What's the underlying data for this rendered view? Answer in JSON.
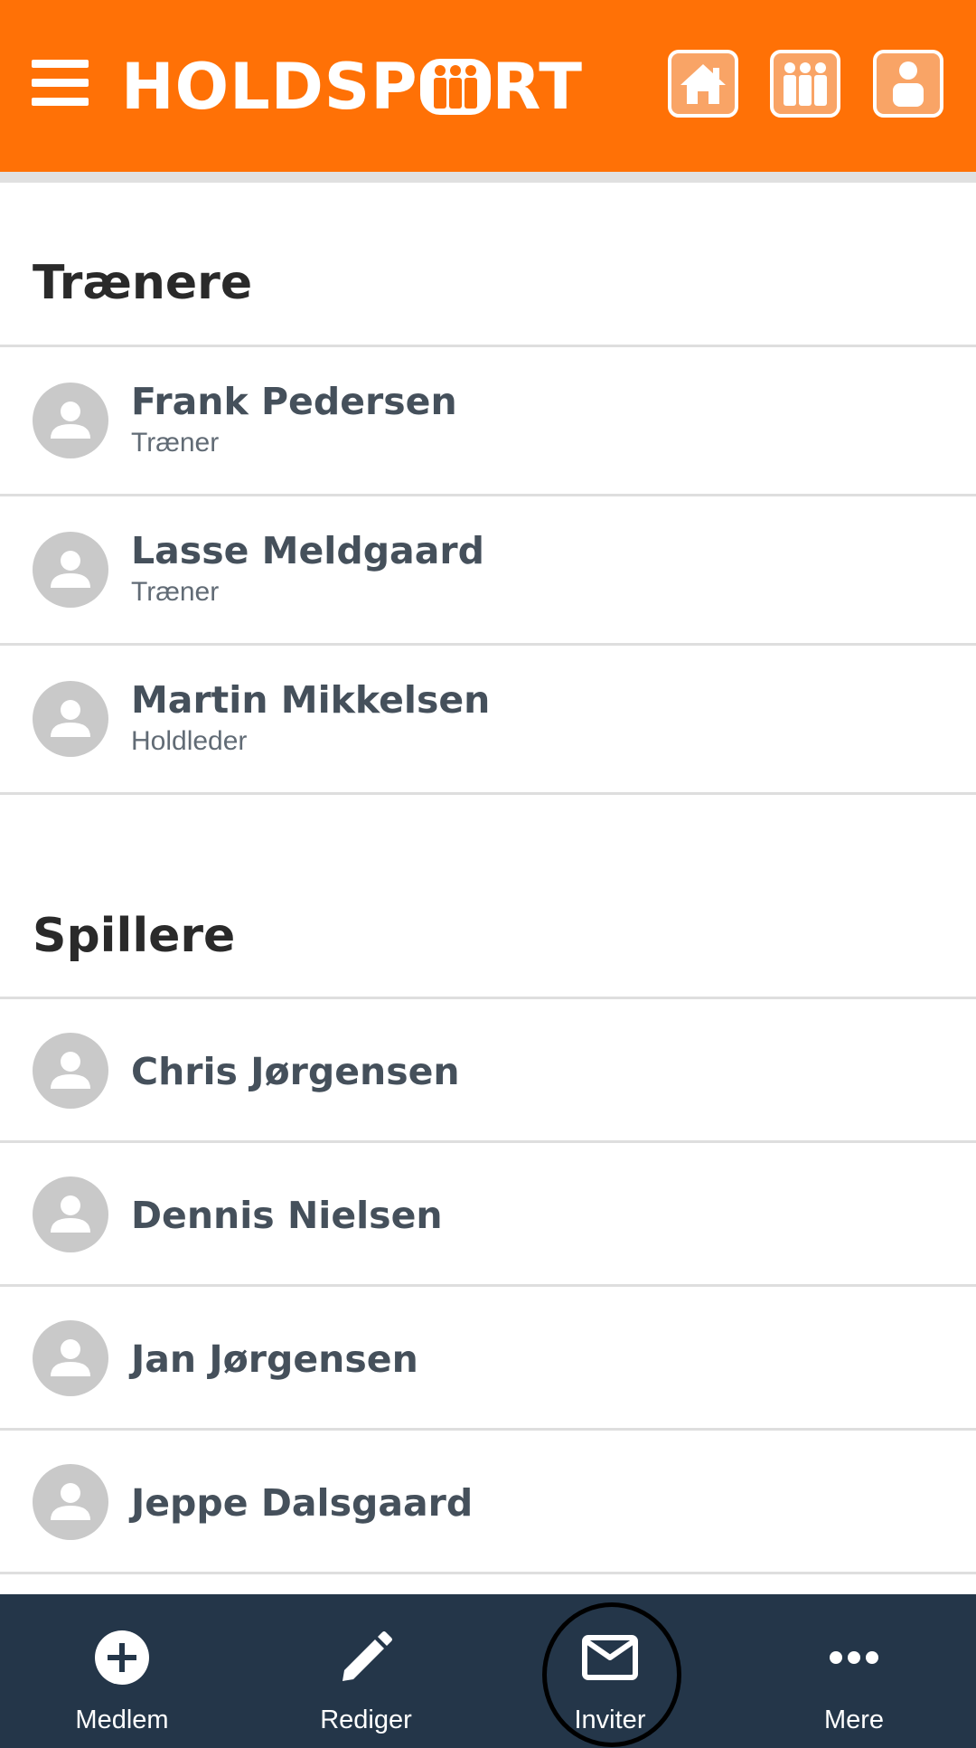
{
  "header": {
    "brand": "HOLDSPORT",
    "brand_before": "HOLDSP",
    "brand_after": "RT",
    "background": "#ff7106",
    "icons": [
      "home-icon",
      "team-icon",
      "profile-icon"
    ]
  },
  "sections": {
    "coaches": {
      "title": "Trænere",
      "members": [
        {
          "name": "Frank Pedersen",
          "role": "Træner"
        },
        {
          "name": "Lasse Meldgaard",
          "role": "Træner"
        },
        {
          "name": "Martin Mikkelsen",
          "role": "Holdleder"
        }
      ]
    },
    "players": {
      "title": "Spillere",
      "members": [
        {
          "name": "Chris Jørgensen"
        },
        {
          "name": "Dennis Nielsen"
        },
        {
          "name": "Jan Jørgensen"
        },
        {
          "name": "Jeppe Dalsgaard"
        }
      ]
    }
  },
  "bottom_nav": {
    "background": "#243649",
    "items": [
      {
        "label": "Medlem",
        "icon": "add-circle-icon"
      },
      {
        "label": "Rediger",
        "icon": "pencil-icon"
      },
      {
        "label": "Inviter",
        "icon": "mail-icon"
      },
      {
        "label": "Mere",
        "icon": "more-dots-icon"
      }
    ],
    "highlighted": "Inviter"
  }
}
